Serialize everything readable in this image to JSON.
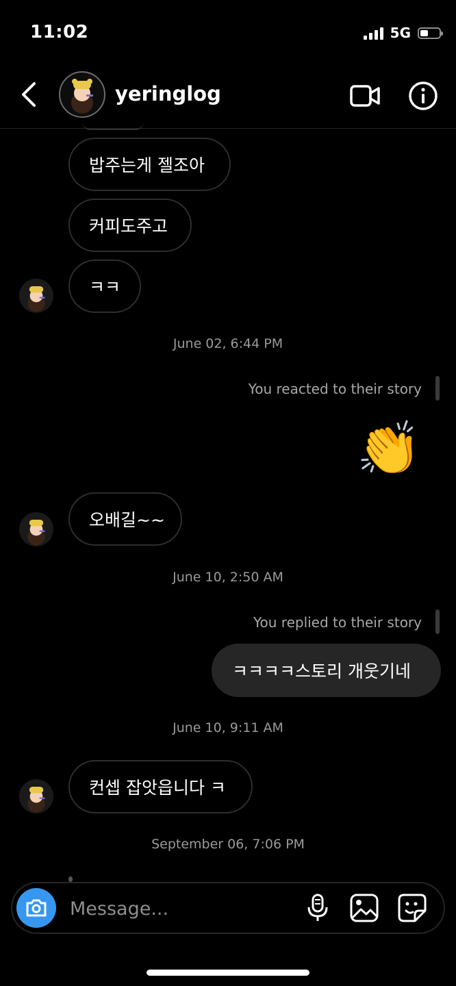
{
  "status_bar": {
    "time": "11:02",
    "network": "5G"
  },
  "header": {
    "username": "yeringlog"
  },
  "messages": [
    {
      "text": "밥주는게 젤조아"
    },
    {
      "text": "커피도주고"
    },
    {
      "text": "ㅋㅋ"
    },
    {
      "text": "오배길~~"
    },
    {
      "text": "ㅋㅋㅋㅋ스토리 개웃기네"
    },
    {
      "text": "컨셉 잡앗읍니다 ㅋ"
    }
  ],
  "timestamps": [
    "June 02, 6:44 PM",
    "June 10, 2:50 AM",
    "June 10, 9:11 AM",
    "September 06, 7:06 PM"
  ],
  "story_notes": {
    "reacted": "You reacted to their story",
    "replied": "You replied to their story"
  },
  "reaction_emoji": "👏",
  "composer": {
    "placeholder": "Message..."
  },
  "icons": {
    "back": "chevron-left-icon",
    "video": "video-camera-icon",
    "info": "info-icon",
    "camera": "camera-icon",
    "mic": "microphone-icon",
    "gallery": "gallery-icon",
    "sticker": "sticker-icon"
  },
  "colors": {
    "accent": "#3797f0",
    "background": "#000000",
    "my_bubble": "#262626"
  }
}
